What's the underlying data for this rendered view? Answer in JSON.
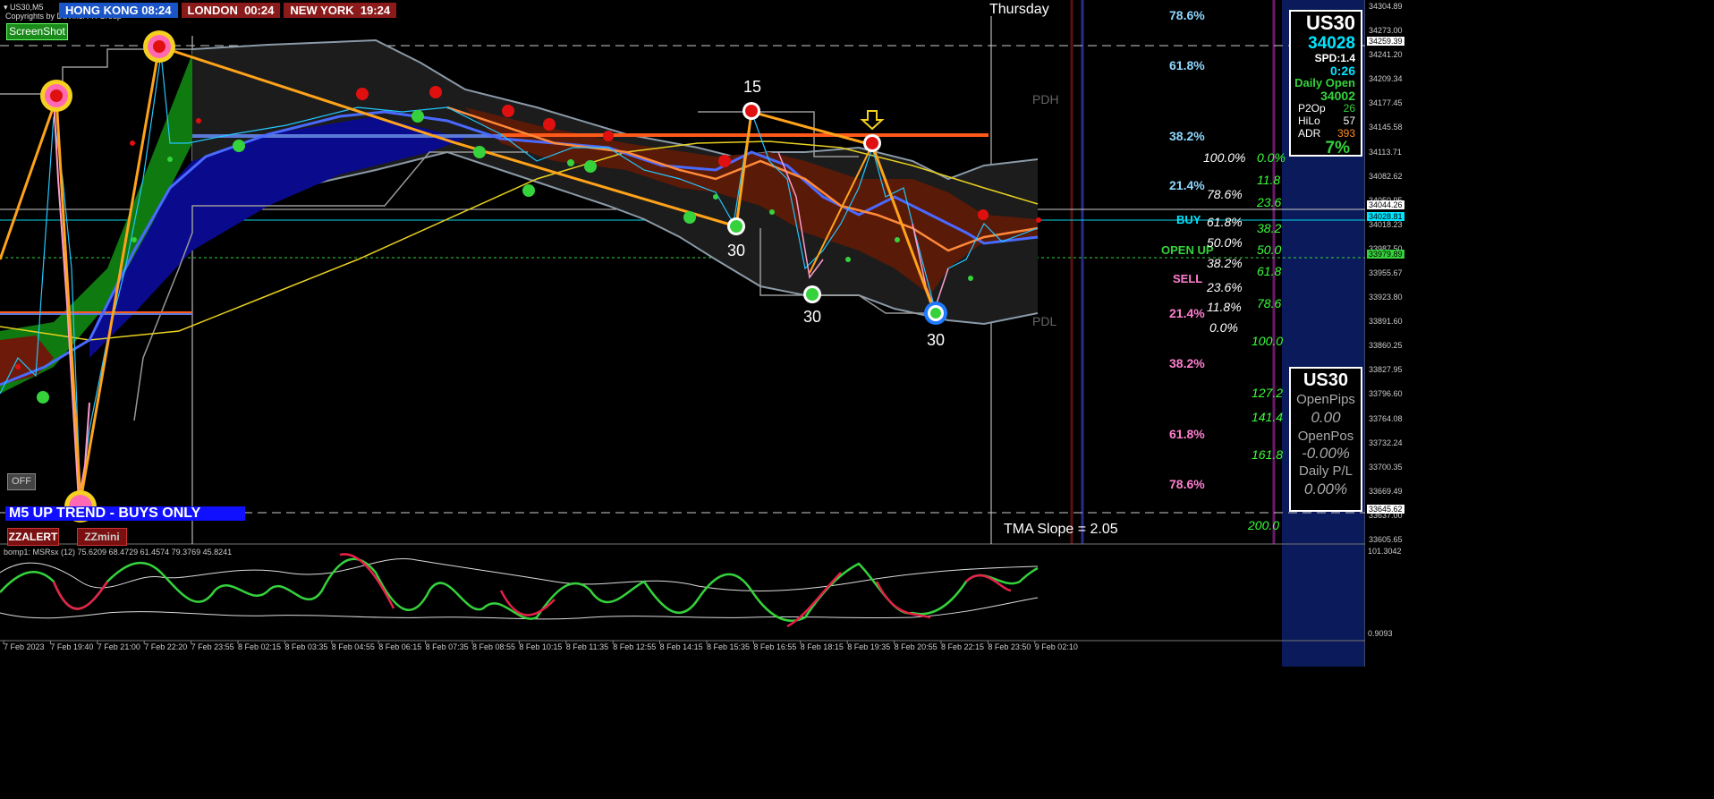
{
  "chart_info": {
    "symbol": "US30,M5",
    "copyright": "Copyrights by DaVinci FX Group"
  },
  "sessions": [
    {
      "city": "HONG KONG",
      "time": "08:24",
      "color": "#1a55c8"
    },
    {
      "city": "LONDON",
      "time": "00:24",
      "color": "#8b1a1a"
    },
    {
      "city": "NEW YORK",
      "time": "19:24",
      "color": "#8b1a1a"
    }
  ],
  "buttons": {
    "screenshot": "ScreenShot",
    "off": "OFF",
    "zzalert": "ZZALERT",
    "zzmini": "ZZmini"
  },
  "labels": {
    "day": "Thursday",
    "trend_banner": "M5 UP TREND - BUYS ONLY",
    "tma_slope": "TMA Slope = 2.05",
    "pdh": "PDH",
    "pdl": "PDL",
    "buy": "BUY",
    "open_up": "OPEN UP",
    "sell": "SELL",
    "zigzag_15": "15",
    "zigzag_30_a": "30",
    "zigzag_30_b": "30",
    "zigzag_30_c": "30"
  },
  "fib_blue": [
    "78.6%",
    "61.8%",
    "38.2%",
    "21.4%"
  ],
  "fib_pink": [
    "21.4%",
    "38.2%",
    "61.8%",
    "78.6%"
  ],
  "fib_white": [
    "100.0%",
    "78.6%",
    "61.8%",
    "50.0%",
    "38.2%",
    "23.6%",
    "11.8%",
    "0.0%"
  ],
  "fib_green": [
    "0.0%",
    "11.8",
    "23.6",
    "38.2",
    "50.0",
    "61.8",
    "78.6",
    "100.0",
    "127.2",
    "141.4",
    "161.8",
    "200.0"
  ],
  "info_panel": {
    "symbol": "US30",
    "price": "34028",
    "spread": "SPD:1.4",
    "timer": "0:26",
    "daily_open_label": "Daily Open",
    "daily_open": "34002",
    "rows": [
      {
        "label": "P2Op",
        "value": "26",
        "color": "#35d23c"
      },
      {
        "label": "HiLo",
        "value": "57",
        "color": "#ffffff"
      },
      {
        "label": "ADR",
        "value": "393",
        "color": "#ff8c1a"
      }
    ],
    "percent": "7%"
  },
  "pips_panel": {
    "symbol": "US30",
    "open_pips_label": "OpenPips",
    "open_pips": "0.00",
    "open_pos_label": "OpenPos",
    "open_pos": "-0.00%",
    "daily_pl_label": "Daily P/L",
    "daily_pl": "0.00%"
  },
  "price_axis": {
    "ticks": [
      "34304.89",
      "34273.00",
      "34241.20",
      "34209.34",
      "34177.45",
      "34145.58",
      "34113.71",
      "34082.62",
      "34050.95",
      "34018.23",
      "33987.50",
      "33955.67",
      "33923.80",
      "33891.60",
      "33860.25",
      "33827.95",
      "33796.60",
      "33764.08",
      "33732.24",
      "33700.35",
      "33669.49",
      "33637.00",
      "33605.65"
    ],
    "highlighted": [
      {
        "value": "34259.39",
        "color": "#ffffff",
        "text_color": "#000000"
      },
      {
        "value": "34044.26",
        "color": "#ffffff",
        "text_color": "#000000"
      },
      {
        "value": "34028.81",
        "color": "#00e5ff",
        "text_color": "#000000"
      },
      {
        "value": "33979.89",
        "color": "#35d23c",
        "text_color": "#000000"
      },
      {
        "value": "33645.62",
        "color": "#ffffff",
        "text_color": "#000000"
      }
    ]
  },
  "oscillator": {
    "title": "bomp1: MSRsx (12) 75.6209 68.4729 61.4574 79.3769 45.8241",
    "max": "101.3042",
    "min": "0.9093"
  },
  "time_axis": [
    "7 Feb 2023",
    "7 Feb 19:40",
    "7 Feb 21:00",
    "7 Feb 22:20",
    "7 Feb 23:55",
    "8 Feb 02:15",
    "8 Feb 03:35",
    "8 Feb 04:55",
    "8 Feb 06:15",
    "8 Feb 07:35",
    "8 Feb 08:55",
    "8 Feb 10:15",
    "8 Feb 11:35",
    "8 Feb 12:55",
    "8 Feb 14:15",
    "8 Feb 15:35",
    "8 Feb 16:55",
    "8 Feb 18:15",
    "8 Feb 19:35",
    "8 Feb 20:55",
    "8 Feb 22:15",
    "8 Feb 23:50",
    "9 Feb 02:10"
  ],
  "colors": {
    "session_blue": "#1a55c8",
    "session_red": "#8b1a1a",
    "zigzag": "#ffa31a",
    "band_blue": "#0a0a8c",
    "band_green": "#0f7a10",
    "band_red": "#6e1a0a",
    "pink_fib": "#ff7fd0",
    "blue_fib": "#8fd8ff",
    "green_fib": "#39ff39"
  }
}
